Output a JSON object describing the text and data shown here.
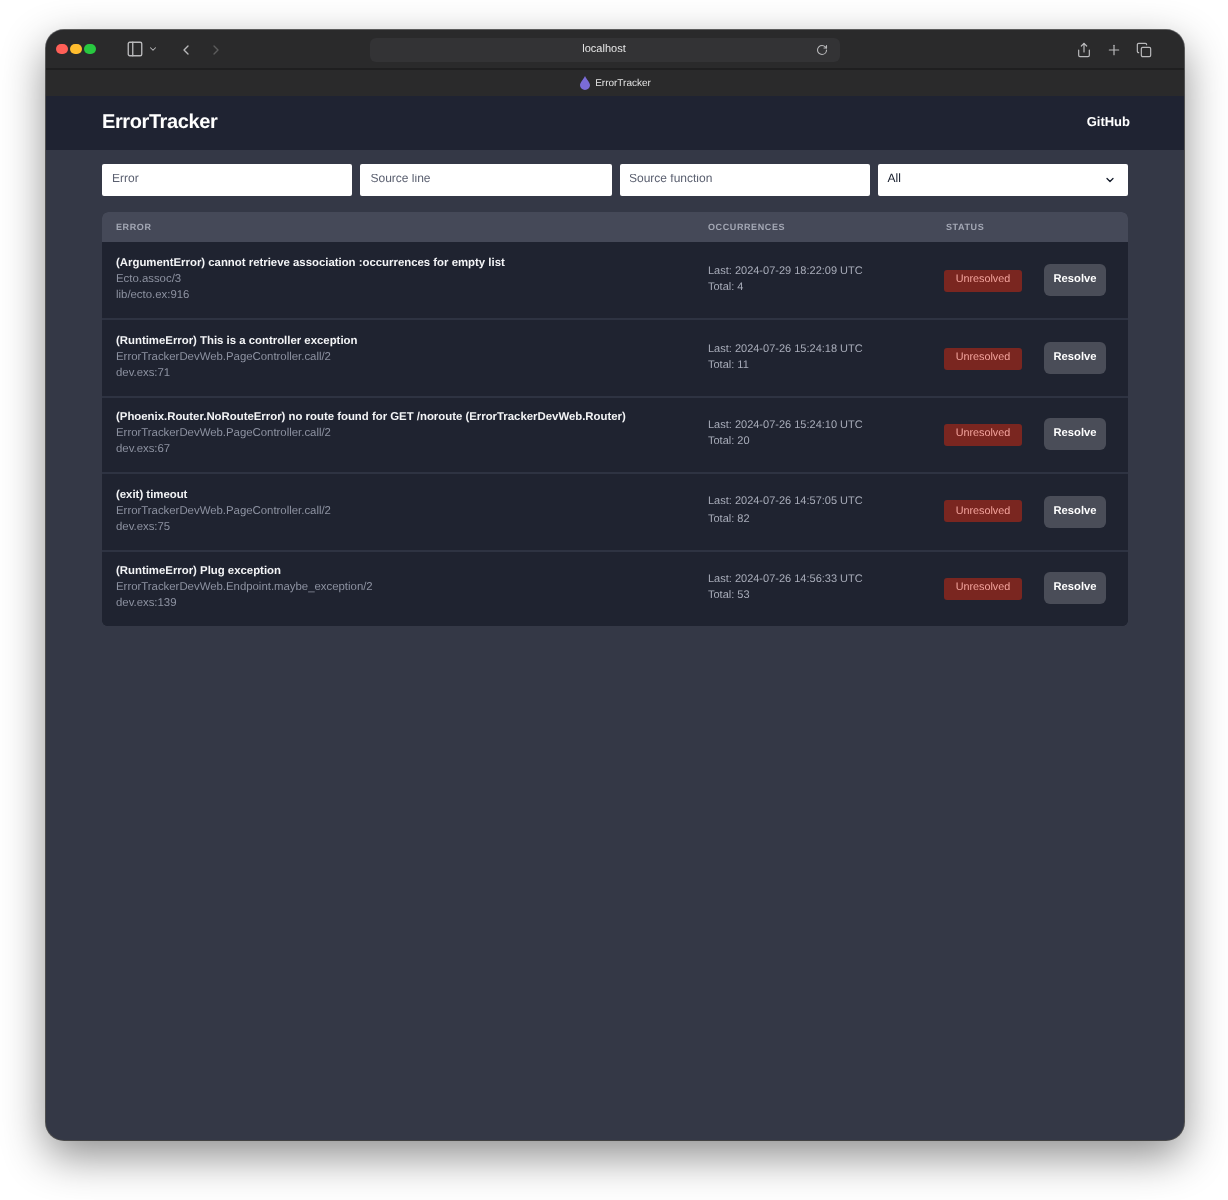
{
  "browser": {
    "address": "localhost",
    "tab": {
      "title": "ErrorTracker"
    },
    "back": {
      "disabled": false
    },
    "forward": {
      "disabled": true
    }
  },
  "header": {
    "title": "ErrorTracker",
    "link": "GitHub"
  },
  "filters": [
    {
      "kind": "text",
      "placeholder": "Error"
    },
    {
      "kind": "text",
      "placeholder": "Source line"
    },
    {
      "kind": "text",
      "placeholder": "Source function"
    },
    {
      "kind": "select",
      "value": "All"
    }
  ],
  "table": {
    "columns": [
      "ERROR",
      "OCCURRENCES",
      "STATUS"
    ],
    "rows": [
      {
        "error": "(ArgumentError) cannot retrieve association :occurrences for empty list",
        "source_function": "Ecto.assoc/3",
        "source_line": "lib/ecto.ex:916",
        "last": "Last: 2024-07-29 18:22:09 UTC",
        "total": "Total: 4",
        "status": "Unresolved",
        "action": "Resolve"
      },
      {
        "error": "(RuntimeError) This is a controller exception",
        "source_function": "ErrorTrackerDevWeb.PageController.call/2",
        "source_line": "dev.exs:71",
        "last": "Last: 2024-07-26 15:24:18 UTC",
        "total": "Total: 11",
        "status": "Unresolved",
        "action": "Resolve"
      },
      {
        "error": "(Phoenix.Router.NoRouteError) no route found for GET /noroute (ErrorTrackerDevWeb.Router)",
        "source_function": "ErrorTrackerDevWeb.PageController.call/2",
        "source_line": "dev.exs:67",
        "last": "Last: 2024-07-26 15:24:10 UTC",
        "total": "Total: 20",
        "status": "Unresolved",
        "action": "Resolve"
      },
      {
        "error": "(exit) timeout",
        "source_function": "ErrorTrackerDevWeb.PageController.call/2",
        "source_line": "dev.exs:75",
        "last": "Last: 2024-07-26 14:57:05 UTC",
        "total": "Total: 82",
        "status": "Unresolved",
        "action": "Resolve"
      },
      {
        "error": "(RuntimeError) Plug exception",
        "source_function": "ErrorTrackerDevWeb.Endpoint.maybe_exception/2",
        "source_line": "dev.exs:139",
        "last": "Last: 2024-07-26 14:56:33 UTC",
        "total": "Total: 53",
        "status": "Unresolved",
        "action": "Resolve"
      }
    ]
  }
}
